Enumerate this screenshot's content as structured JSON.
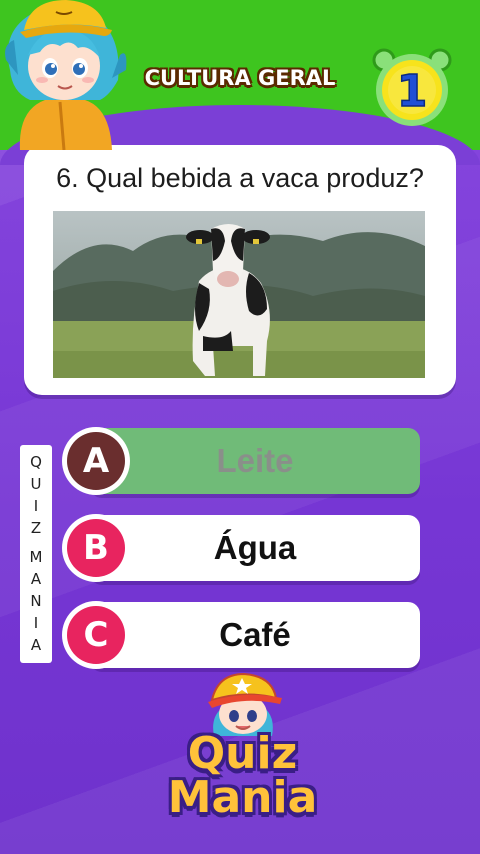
{
  "header": {
    "title": "CULTURA GERAL",
    "timer_value": "1"
  },
  "question": {
    "text": "6. Qual bebida a vaca produz?",
    "image_icon": "cow-photo"
  },
  "side_brand": [
    "Q",
    "U",
    "I",
    "Z",
    "",
    "M",
    "A",
    "N",
    "I",
    "A"
  ],
  "answers": [
    {
      "letter": "A",
      "label": "Leite",
      "state": "correct"
    },
    {
      "letter": "B",
      "label": "Água",
      "state": "default"
    },
    {
      "letter": "C",
      "label": "Café",
      "state": "default"
    }
  ],
  "logo": {
    "line1": "Quiz",
    "line2": "Mania"
  },
  "colors": {
    "header_green": "#3ec51f",
    "background_purple": "#7b3fd6",
    "correct_green": "#70bb78",
    "badge_pink": "#e8245f",
    "badge_brown": "#6a2e2e",
    "logo_yellow": "#ffc23a"
  }
}
